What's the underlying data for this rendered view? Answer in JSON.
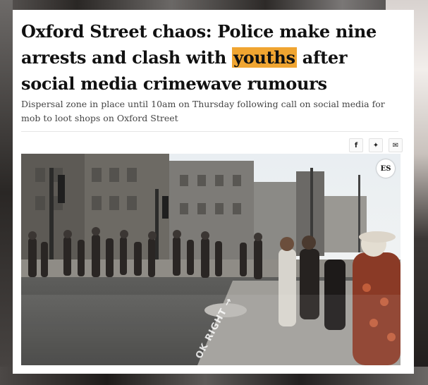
{
  "article": {
    "headline_part1": "Oxford Street chaos: Police make nine arrests and clash with ",
    "headline_highlight": "youths",
    "headline_part2": " after social media crimewave rumours",
    "standfirst": "Dispersal zone in place until 10am on Thursday following call on social media for mob to loot shops on Oxford Street"
  },
  "share": {
    "facebook": "f",
    "twitter": "✦",
    "email": "✉"
  },
  "photo": {
    "badge": "ES",
    "road_marking": "OK RIGHT →"
  },
  "colors": {
    "highlight": "#f0a531",
    "headline": "#111111",
    "standfirst": "#444444"
  },
  "icons": [
    "facebook-icon",
    "twitter-icon",
    "email-icon"
  ]
}
